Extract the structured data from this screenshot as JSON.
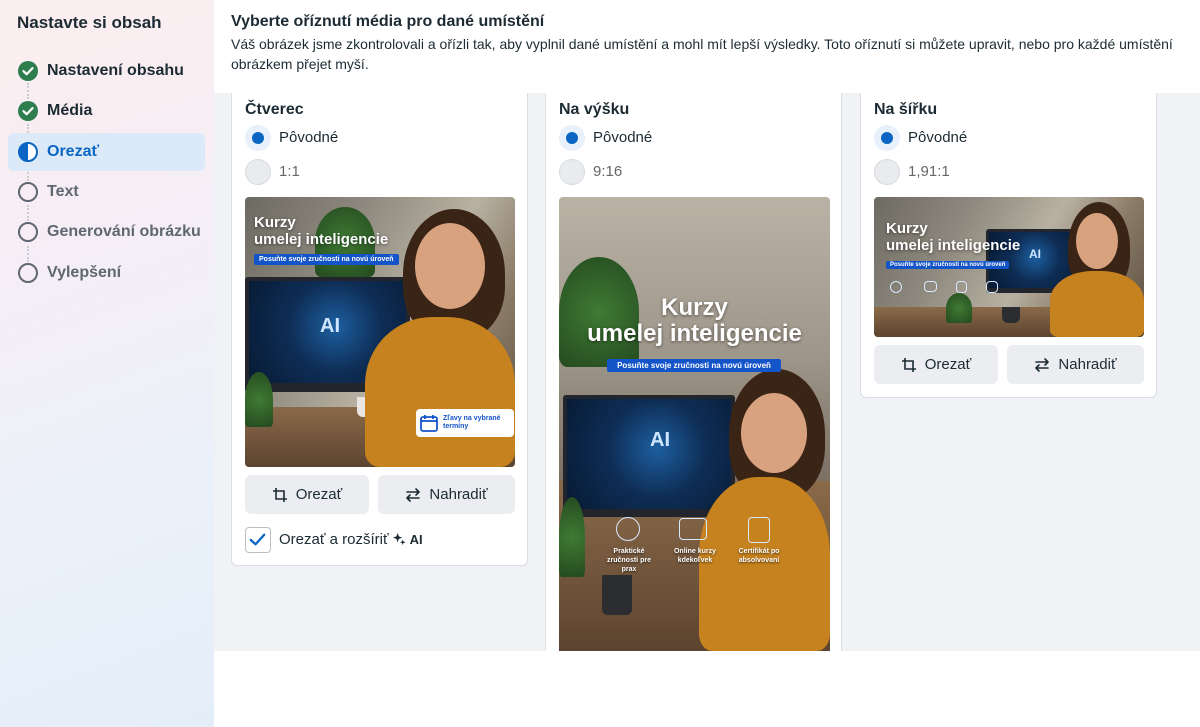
{
  "sidebar": {
    "title": "Nastavte si obsah",
    "steps": [
      {
        "label": "Nastavení obsahu",
        "state": "done",
        "icon": "check-circle-icon"
      },
      {
        "label": "Média",
        "state": "done",
        "icon": "check-circle-icon"
      },
      {
        "label": "Orezať",
        "state": "active",
        "icon": "half-circle-icon"
      },
      {
        "label": "Text",
        "state": "todo",
        "icon": "empty-circle-icon"
      },
      {
        "label": "Generování obrázku",
        "state": "todo",
        "icon": "empty-circle-icon"
      },
      {
        "label": "Vylepšení",
        "state": "todo",
        "icon": "empty-circle-icon"
      }
    ]
  },
  "header": {
    "title": "Vyberte oříznutí média pro dané umístění",
    "description": "Váš obrázek jsme zkontrolovali a ořízli tak, aby vyplnil dané umístění a mohl mít lepší výsledky. Toto oříznutí si můžete upravit, nebo pro každé umístění\nobrázkem přejet myší."
  },
  "cards": {
    "square": {
      "title": "Čtverec",
      "option_original": "Pôvodné",
      "option_ratio": "1:1",
      "crop_button": "Orezať",
      "replace_button": "Nahradiť",
      "checkbox_label": "Orezať a rozšíriť",
      "ai_label": "AI",
      "checkbox_checked": true,
      "image": {
        "headline_line1": "Kurzy",
        "headline_line2": "umelej inteligencie",
        "pill": "Posuňte svoje zručnosti na novú úroveň",
        "screen_text": "AI",
        "badge_text": "Zľavy na vybrané termíny"
      }
    },
    "vertical": {
      "title": "Na výšku",
      "option_original": "Pôvodné",
      "option_ratio": "9:16",
      "image": {
        "headline_line1": "Kurzy",
        "headline_line2": "umelej inteligencie",
        "pill": "Posuňte svoje zručnosti na novú úroveň",
        "screen_text": "AI",
        "feature1": "Praktické zručnosti pre prax",
        "feature2": "Online kurzy kdekoľvek",
        "feature3": "Certifikát po absolvovaní"
      }
    },
    "landscape": {
      "title": "Na šířku",
      "option_original": "Pôvodné",
      "option_ratio": "1,91:1",
      "crop_button": "Orezať",
      "replace_button": "Nahradiť",
      "image": {
        "headline_line1": "Kurzy",
        "headline_line2": "umelej inteligencie",
        "pill": "Posuňte svoje zručnosti na novú úroveň",
        "screen_text": "AI"
      }
    }
  },
  "colors": {
    "accent": "#0a66c2",
    "done_green": "#2e7d4f",
    "canvas": "#f0f2f5"
  }
}
